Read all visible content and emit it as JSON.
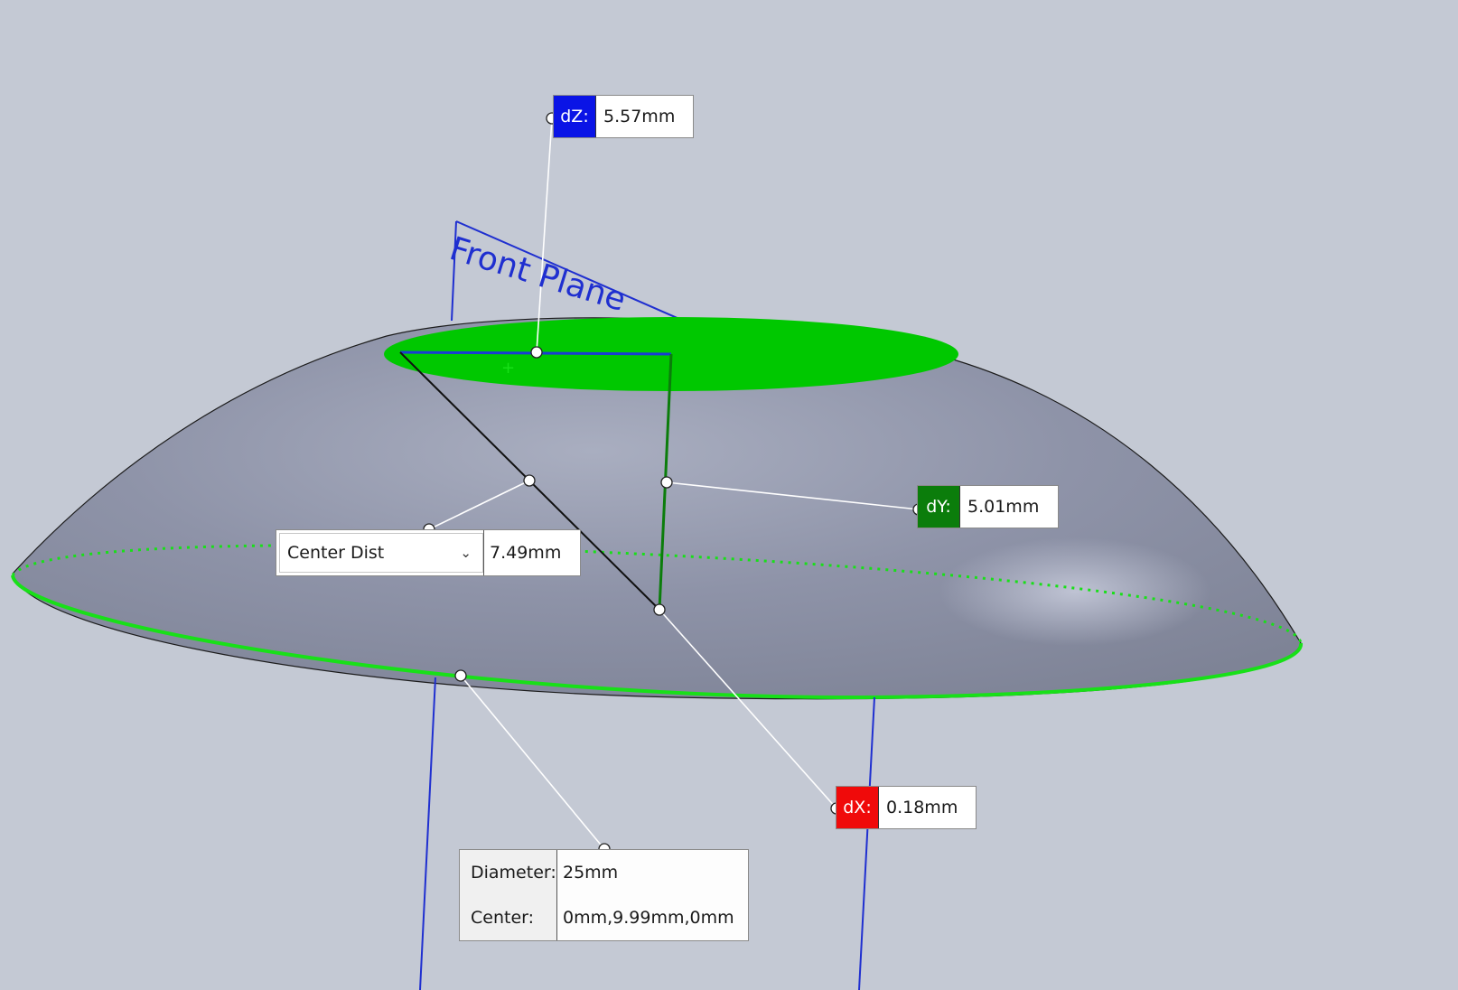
{
  "front_plane": {
    "label": "Front Plane"
  },
  "measurements": {
    "dz": {
      "tag": "dZ:",
      "value": "5.57mm",
      "color": "#0a14e6"
    },
    "dy": {
      "tag": "dY:",
      "value": "5.01mm",
      "color": "#0b7d0b"
    },
    "dx": {
      "tag": "dX:",
      "value": "0.18mm",
      "color": "#f00a0a"
    }
  },
  "center_dist": {
    "mode": "Center Dist",
    "value": "7.49mm"
  },
  "info_box": {
    "diameter_label": "Diameter:",
    "diameter_value": "25mm",
    "center_label": "Center:",
    "center_value": "0mm,9.99mm,0mm"
  },
  "colors": {
    "background": "#c4c9d4",
    "selection_green": "#00c800",
    "plane_blue": "#1f2fd0",
    "dome_gray": "#8a8fa3"
  }
}
